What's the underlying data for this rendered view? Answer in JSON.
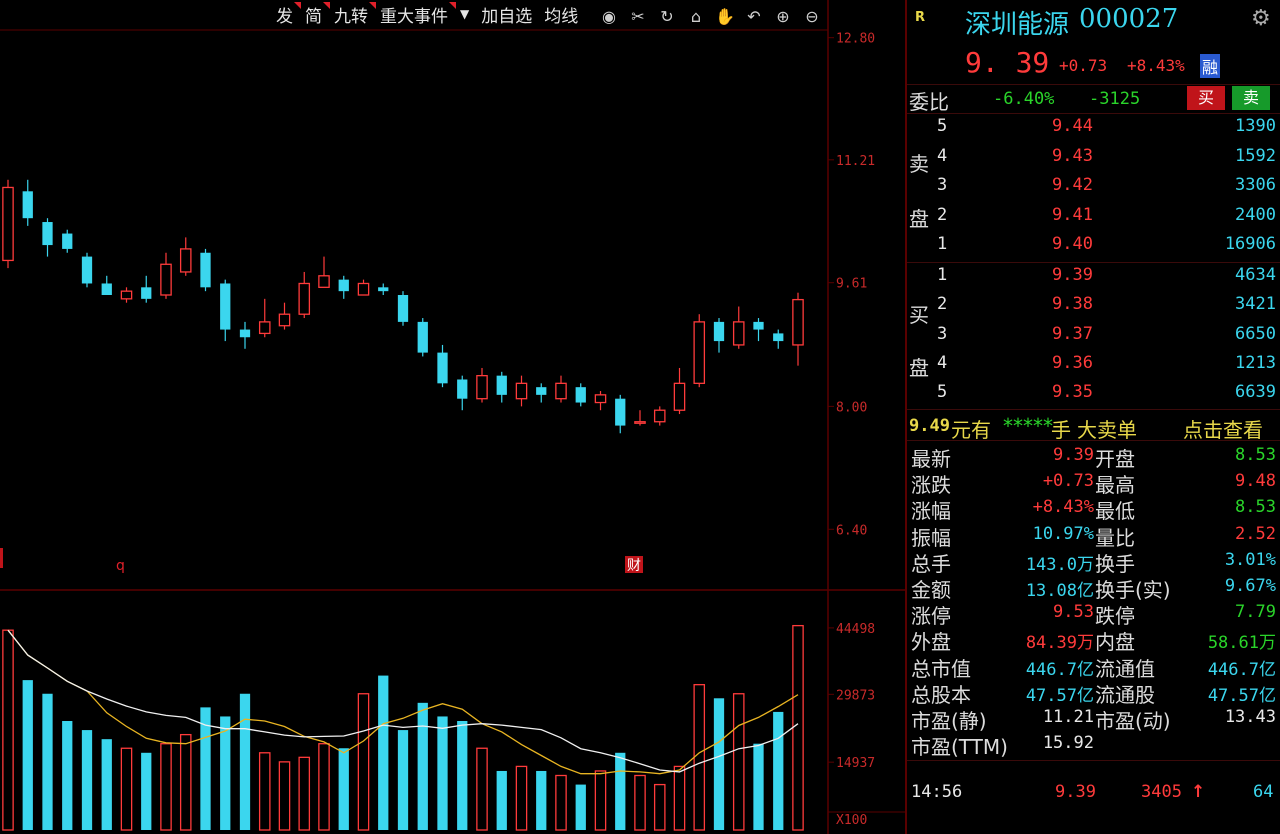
{
  "toolbar": {
    "items": [
      "发",
      "简",
      "九转",
      "重大事件",
      "加自选",
      "均线"
    ]
  },
  "price_axis": [
    "12.80",
    "11.21",
    "9.61",
    "8.00",
    "6.40"
  ],
  "volume_axis": [
    "44498",
    "29873",
    "14937",
    "X100"
  ],
  "markers": [
    "q",
    "财"
  ],
  "stock": {
    "badge": "R",
    "name": "深圳能源",
    "code": "000027",
    "price": "9. 39",
    "change": "+0.73",
    "change_pct": "+8.43%",
    "tag": "融"
  },
  "weibi": {
    "label": "委比",
    "pct": "-6.40%",
    "diff": "-3125",
    "buy_btn": "买",
    "sell_btn": "卖"
  },
  "sell_side": {
    "label_1": "卖",
    "label_2": "盘",
    "levels": [
      {
        "lvl": "5",
        "price": "9.44",
        "vol": "1390"
      },
      {
        "lvl": "4",
        "price": "9.43",
        "vol": "1592"
      },
      {
        "lvl": "3",
        "price": "9.42",
        "vol": "3306"
      },
      {
        "lvl": "2",
        "price": "9.41",
        "vol": "2400"
      },
      {
        "lvl": "1",
        "price": "9.40",
        "vol": "16906"
      }
    ]
  },
  "buy_side": {
    "label_1": "买",
    "label_2": "盘",
    "levels": [
      {
        "lvl": "1",
        "price": "9.39",
        "vol": "4634"
      },
      {
        "lvl": "2",
        "price": "9.38",
        "vol": "3421"
      },
      {
        "lvl": "3",
        "price": "9.37",
        "vol": "6650"
      },
      {
        "lvl": "4",
        "price": "9.36",
        "vol": "1213"
      },
      {
        "lvl": "5",
        "price": "9.35",
        "vol": "6639"
      }
    ]
  },
  "big_order": {
    "price": "9.49",
    "text1": "元有",
    "stars": "*****",
    "text2": "手",
    "text3": "大卖单",
    "link": "点击查看"
  },
  "stats": [
    {
      "l1": "最新",
      "v1": "9.39",
      "c1": "red",
      "l2": "开盘",
      "v2": "8.53",
      "c2": "green"
    },
    {
      "l1": "涨跌",
      "v1": "+0.73",
      "c1": "red",
      "l2": "最高",
      "v2": "9.48",
      "c2": "red"
    },
    {
      "l1": "涨幅",
      "v1": "+8.43%",
      "c1": "red",
      "l2": "最低",
      "v2": "8.53",
      "c2": "green"
    },
    {
      "l1": "振幅",
      "v1": "10.97%",
      "c1": "cyan",
      "l2": "量比",
      "v2": "2.52",
      "c2": "red"
    },
    {
      "l1": "总手",
      "v1": "143.0万",
      "c1": "cyan",
      "l2": "换手",
      "v2": "3.01%",
      "c2": "cyan"
    },
    {
      "l1": "金额",
      "v1": "13.08亿",
      "c1": "cyan",
      "l2": "换手(实)",
      "v2": "9.67%",
      "c2": "cyan"
    },
    {
      "l1": "涨停",
      "v1": "9.53",
      "c1": "red",
      "l2": "跌停",
      "v2": "7.79",
      "c2": "green"
    },
    {
      "l1": "外盘",
      "v1": "84.39万",
      "c1": "red",
      "l2": "内盘",
      "v2": "58.61万",
      "c2": "green"
    },
    {
      "l1": "总市值",
      "v1": "446.7亿",
      "c1": "cyan",
      "l2": "流通值",
      "v2": "446.7亿",
      "c2": "cyan"
    },
    {
      "l1": "总股本",
      "v1": "47.57亿",
      "c1": "cyan",
      "l2": "流通股",
      "v2": "47.57亿",
      "c2": "cyan"
    },
    {
      "l1": "市盈(静)",
      "v1": "11.21",
      "c1": "white",
      "l2": "市盈(动)",
      "v2": "13.43",
      "c2": "white"
    },
    {
      "l1": "市盈(TTM)",
      "v1": "15.92",
      "c1": "white",
      "l2": "",
      "v2": "",
      "c2": "white"
    }
  ],
  "tick": {
    "time": "14:56",
    "price": "9.39",
    "vol": "3405",
    "arrow": "↑",
    "count": "64"
  },
  "colors": {
    "up": "#ff3b3b",
    "down": "#3bd6ee",
    "grid": "#5a0000"
  },
  "chart_data": {
    "type": "candlestick",
    "ylim": [
      6.0,
      12.9
    ],
    "candles": [
      [
        9.9,
        10.85,
        10.95,
        9.8
      ],
      [
        10.8,
        10.45,
        10.95,
        10.35
      ],
      [
        10.4,
        10.1,
        10.45,
        9.95
      ],
      [
        10.25,
        10.05,
        10.3,
        10.0
      ],
      [
        9.95,
        9.6,
        10.0,
        9.55
      ],
      [
        9.6,
        9.45,
        9.7,
        9.45
      ],
      [
        9.4,
        9.5,
        9.55,
        9.35
      ],
      [
        9.55,
        9.4,
        9.7,
        9.35
      ],
      [
        9.45,
        9.85,
        10.0,
        9.4
      ],
      [
        9.75,
        10.05,
        10.2,
        9.7
      ],
      [
        10.0,
        9.55,
        10.05,
        9.5
      ],
      [
        9.6,
        9.0,
        9.65,
        8.85
      ],
      [
        9.0,
        8.9,
        9.1,
        8.75
      ],
      [
        8.95,
        9.1,
        9.4,
        8.9
      ],
      [
        9.05,
        9.2,
        9.35,
        9.0
      ],
      [
        9.2,
        9.6,
        9.75,
        9.15
      ],
      [
        9.55,
        9.7,
        9.95,
        9.55
      ],
      [
        9.65,
        9.5,
        9.7,
        9.4
      ],
      [
        9.45,
        9.6,
        9.65,
        9.45
      ],
      [
        9.55,
        9.5,
        9.6,
        9.45
      ],
      [
        9.45,
        9.1,
        9.5,
        9.05
      ],
      [
        9.1,
        8.7,
        9.15,
        8.65
      ],
      [
        8.7,
        8.3,
        8.8,
        8.25
      ],
      [
        8.35,
        8.1,
        8.4,
        7.95
      ],
      [
        8.1,
        8.4,
        8.5,
        8.05
      ],
      [
        8.4,
        8.15,
        8.45,
        8.05
      ],
      [
        8.1,
        8.3,
        8.4,
        8.0
      ],
      [
        8.25,
        8.15,
        8.3,
        8.05
      ],
      [
        8.1,
        8.3,
        8.4,
        8.05
      ],
      [
        8.25,
        8.05,
        8.3,
        8.0
      ],
      [
        8.05,
        8.15,
        8.2,
        7.95
      ],
      [
        8.1,
        7.75,
        8.15,
        7.65
      ],
      [
        7.8,
        7.8,
        7.95,
        7.75
      ],
      [
        7.8,
        7.95,
        8.0,
        7.75
      ],
      [
        7.95,
        8.3,
        8.5,
        7.9
      ],
      [
        8.3,
        9.1,
        9.2,
        8.25
      ],
      [
        9.1,
        8.85,
        9.15,
        8.7
      ],
      [
        8.8,
        9.1,
        9.3,
        8.75
      ],
      [
        9.1,
        9.0,
        9.15,
        8.85
      ],
      [
        8.95,
        8.85,
        9.0,
        8.75
      ],
      [
        8.8,
        9.39,
        9.48,
        8.53
      ]
    ],
    "volumes": [
      44000,
      33000,
      30000,
      24000,
      22000,
      20000,
      18000,
      17000,
      19000,
      21000,
      27000,
      25000,
      30000,
      17000,
      15000,
      16000,
      19000,
      18000,
      30000,
      34000,
      22000,
      28000,
      25000,
      24000,
      18000,
      13000,
      14000,
      13000,
      12000,
      10000,
      13000,
      17000,
      12000,
      10000,
      14000,
      32000,
      29000,
      30000,
      19000,
      26000,
      45000
    ],
    "vol_ylim": [
      0,
      48000
    ]
  }
}
